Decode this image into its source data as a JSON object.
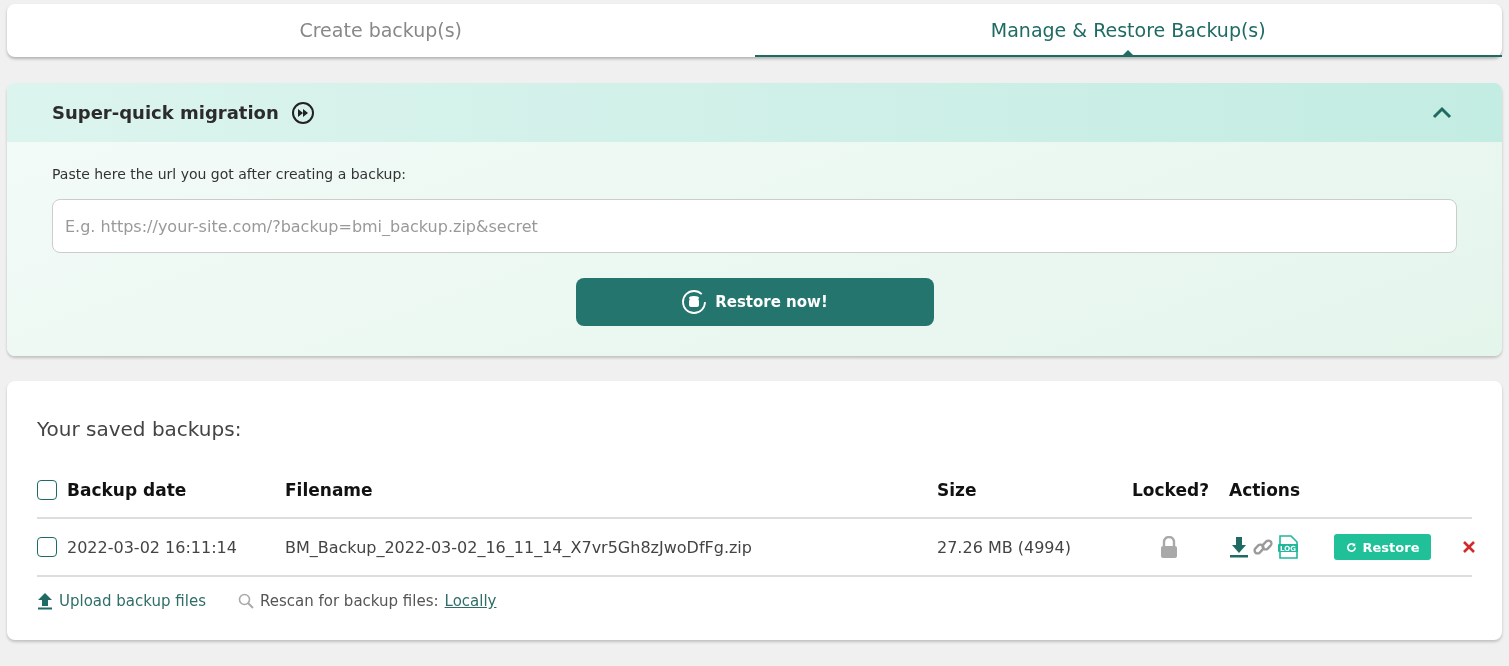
{
  "tabs": [
    {
      "label": "Create backup(s)",
      "selected": false
    },
    {
      "label": "Manage & Restore Backup(s)",
      "selected": true
    }
  ],
  "migration": {
    "title": "Super-quick migration",
    "expanded": true,
    "label": "Paste here the url you got after creating a backup:",
    "placeholder": "E.g. https://your-site.com/?backup=bmi_backup.zip&secret",
    "button": "Restore now!"
  },
  "backups": {
    "title": "Your saved backups:",
    "select_all_checked": false,
    "columns": [
      "Backup date",
      "Filename",
      "Size",
      "Locked?",
      "Actions"
    ],
    "rows": [
      {
        "checked": false,
        "date": "2022-03-02 16:11:14",
        "filename": "BM_Backup_2022-03-02_16_11_14_X7vr5Gh8zJwoDfFg.zip",
        "size": "27.26 MB (4994)",
        "locked": false,
        "log_label": "LOG",
        "restore": "Restore"
      }
    ],
    "upload": "Upload backup files",
    "rescan": "Rescan for backup files:",
    "rescan_link": "Locally"
  }
}
